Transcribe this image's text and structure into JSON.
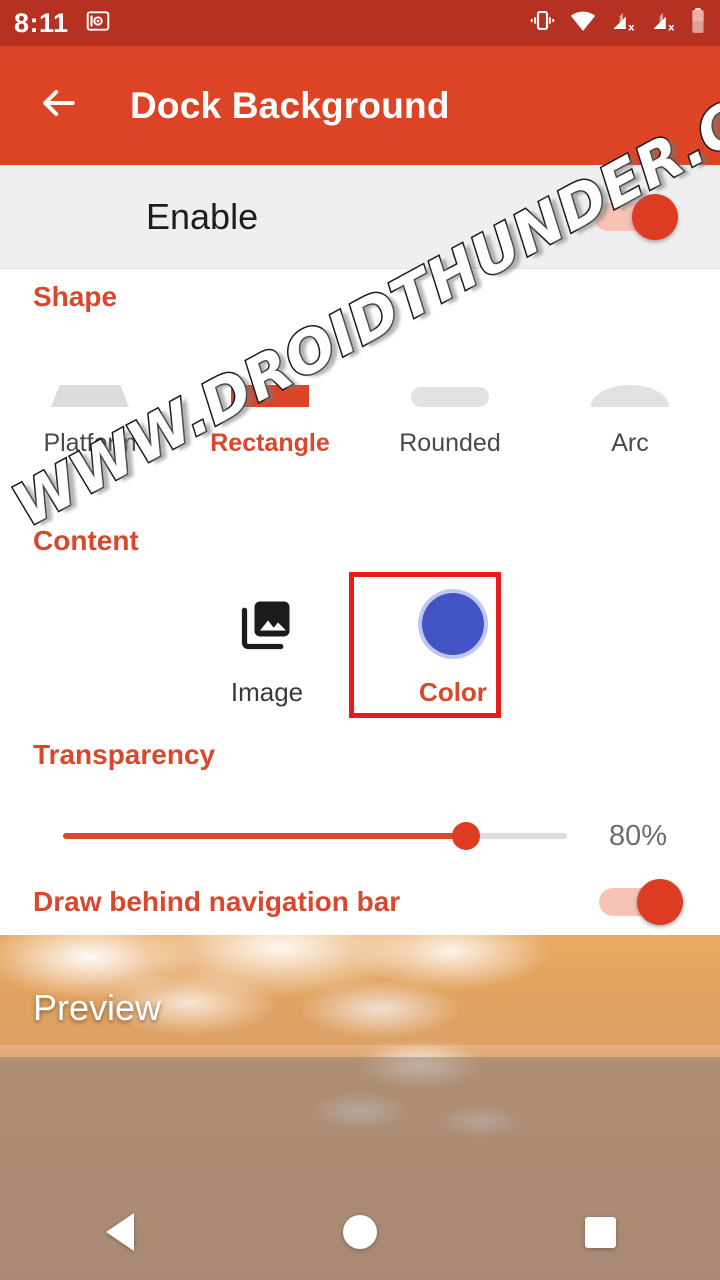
{
  "status_bar": {
    "time": "8:11",
    "left_icons": [
      "screenshot-capture-icon"
    ],
    "right_icons": [
      "vibrate-icon",
      "wifi-icon",
      "signal-no-sim-1-icon",
      "signal-no-sim-2-icon",
      "battery-icon"
    ],
    "background_color": "#b63122"
  },
  "app_bar": {
    "back_icon": "back-arrow-icon",
    "title": "Dock Background",
    "background_color": "#dd4426",
    "text_color": "#ffffff"
  },
  "enable_row": {
    "label": "Enable",
    "toggle_state": "on",
    "toggle_color": "#dd3b22",
    "background_color": "#efefef"
  },
  "shape_section": {
    "title": "Shape",
    "accent_color": "#d9472c",
    "options": [
      {
        "label": "Platform",
        "icon": "shape-platform-icon",
        "selected": false
      },
      {
        "label": "Rectangle",
        "icon": "shape-rectangle-icon",
        "selected": true
      },
      {
        "label": "Rounded",
        "icon": "shape-rounded-icon",
        "selected": false
      },
      {
        "label": "Arc",
        "icon": "shape-arc-icon",
        "selected": false
      }
    ]
  },
  "content_section": {
    "title": "Content",
    "options": [
      {
        "label": "Image",
        "icon": "photo-library-icon",
        "selected": false
      },
      {
        "label": "Color",
        "icon": "color-swatch-icon",
        "selected": true,
        "swatch_color": "#4254c5"
      }
    ],
    "highlight_box_color": "#e81b1b"
  },
  "transparency_section": {
    "title": "Transparency",
    "value": 80,
    "value_text": "80%",
    "fill_color": "#d9472c",
    "track_color": "#dedede"
  },
  "draw_behind_nav": {
    "label": "Draw behind navigation bar",
    "toggle_state": "on"
  },
  "preview": {
    "label": "Preview",
    "wallpaper": "beach-waves-sand",
    "dock_overlay_color": "rgba(150,128,112,.55)"
  },
  "nav_bar": {
    "buttons": [
      {
        "name": "back",
        "icon": "nav-back-triangle-icon"
      },
      {
        "name": "home",
        "icon": "nav-home-circle-icon"
      },
      {
        "name": "recents",
        "icon": "nav-recents-square-icon"
      }
    ]
  },
  "watermark": {
    "text": "WWW.DROIDTHUNDER.COM"
  }
}
